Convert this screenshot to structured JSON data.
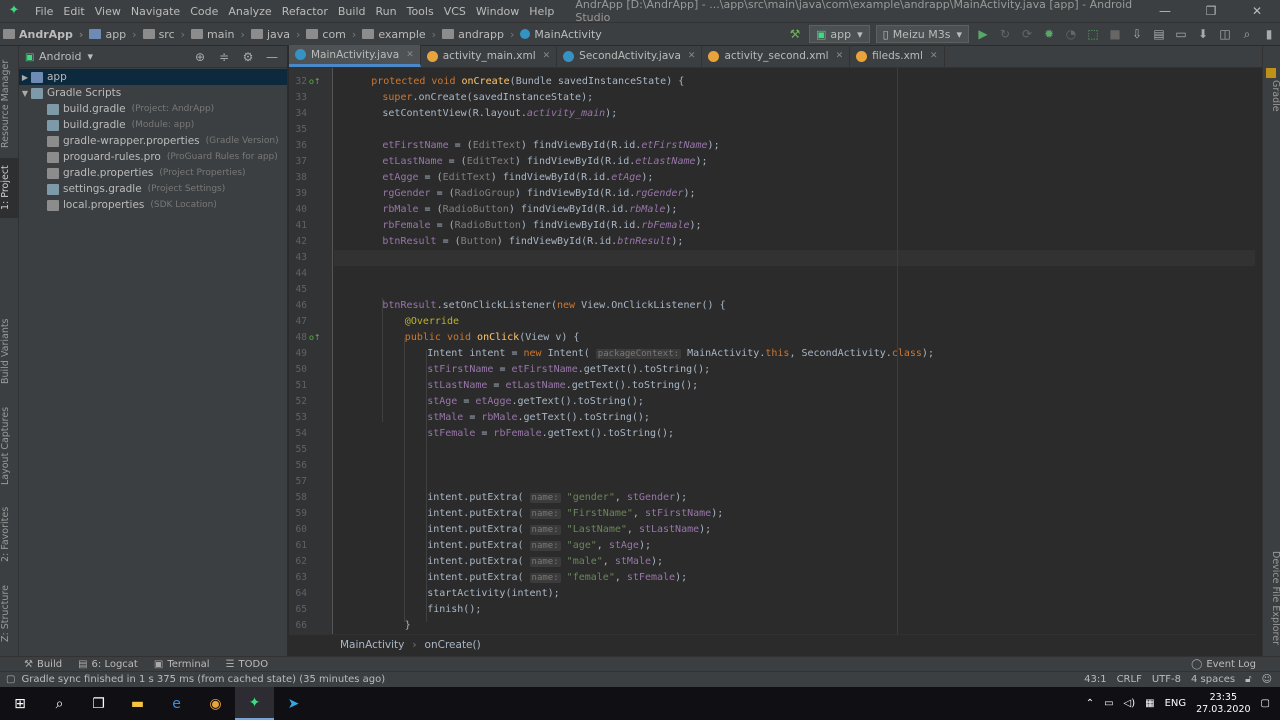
{
  "window": {
    "app_icon": "android-studio-icon",
    "title": "AndrApp [D:\\AndrApp] - ...\\app\\src\\main\\java\\com\\example\\andrapp\\MainActivity.java [app] - Android Studio",
    "menu": [
      "File",
      "Edit",
      "View",
      "Navigate",
      "Code",
      "Analyze",
      "Refactor",
      "Build",
      "Run",
      "Tools",
      "VCS",
      "Window",
      "Help"
    ]
  },
  "breadcrumbs": [
    "AndrApp",
    "app",
    "src",
    "main",
    "java",
    "com",
    "example",
    "andrapp",
    "MainActivity"
  ],
  "toolbar": {
    "run_config": "app",
    "device": "Meizu M3s"
  },
  "left_tool_tabs": [
    "Resource Manager",
    "1: Project",
    "Build Variants",
    "Layout Captures",
    "2: Favorites",
    "Z: Structure"
  ],
  "right_tool_tabs": [
    "Gradle",
    "Device File Explorer"
  ],
  "project": {
    "view": "Android",
    "tree": [
      {
        "label": "app",
        "hint": "",
        "level": 0,
        "arrow": "▶",
        "type": "folder"
      },
      {
        "label": "Gradle Scripts",
        "hint": "",
        "level": 0,
        "arrow": "▼",
        "type": "gradle"
      },
      {
        "label": "build.gradle",
        "hint": "(Project: AndrApp)",
        "level": 1,
        "arrow": "",
        "type": "gradle"
      },
      {
        "label": "build.gradle",
        "hint": "(Module: app)",
        "level": 1,
        "arrow": "",
        "type": "gradle"
      },
      {
        "label": "gradle-wrapper.properties",
        "hint": "(Gradle Version)",
        "level": 1,
        "arrow": "",
        "type": "props"
      },
      {
        "label": "proguard-rules.pro",
        "hint": "(ProGuard Rules for app)",
        "level": 1,
        "arrow": "",
        "type": "file"
      },
      {
        "label": "gradle.properties",
        "hint": "(Project Properties)",
        "level": 1,
        "arrow": "",
        "type": "props"
      },
      {
        "label": "settings.gradle",
        "hint": "(Project Settings)",
        "level": 1,
        "arrow": "",
        "type": "gradle"
      },
      {
        "label": "local.properties",
        "hint": "(SDK Location)",
        "level": 1,
        "arrow": "",
        "type": "props"
      }
    ]
  },
  "tabs": [
    {
      "label": "MainActivity.java",
      "active": true,
      "color": "#3592c4"
    },
    {
      "label": "activity_main.xml",
      "active": false,
      "color": "#e8a33d"
    },
    {
      "label": "SecondActivity.java",
      "active": false,
      "color": "#3592c4"
    },
    {
      "label": "activity_second.xml",
      "active": false,
      "color": "#e8a33d"
    },
    {
      "label": "fileds.xml",
      "active": false,
      "color": "#e8a33d"
    }
  ],
  "editor": {
    "cursor_line": 43,
    "gutter_marks": {
      "32": "o↑",
      "48": "o↑"
    },
    "lines": [
      {
        "n": 32,
        "i": 2,
        "t": [
          [
            "kw",
            "protected void "
          ],
          [
            "fn",
            "onCreate"
          ],
          [
            "",
            "(Bundle savedInstanceState) {"
          ]
        ]
      },
      {
        "n": 33,
        "i": 4,
        "t": [
          [
            "kw",
            "super"
          ],
          [
            "",
            ".onCreate(savedInstanceState);"
          ]
        ]
      },
      {
        "n": 34,
        "i": 4,
        "t": [
          [
            "",
            "setContentView(R.layout."
          ],
          [
            "fldi",
            "activity_main"
          ],
          [
            "",
            ");"
          ]
        ]
      },
      {
        "n": 35,
        "i": 0,
        "t": []
      },
      {
        "n": 36,
        "i": 4,
        "t": [
          [
            "fld",
            "etFirstName"
          ],
          [
            "",
            " = ("
          ],
          [
            "cast",
            "EditText"
          ],
          [
            "",
            ") findViewById(R.id."
          ],
          [
            "fldi",
            "etFirstName"
          ],
          [
            "",
            ");"
          ]
        ]
      },
      {
        "n": 37,
        "i": 4,
        "t": [
          [
            "fld",
            "etLastName"
          ],
          [
            "",
            " = ("
          ],
          [
            "cast",
            "EditText"
          ],
          [
            "",
            ") findViewById(R.id."
          ],
          [
            "fldi",
            "etLastName"
          ],
          [
            "",
            ");"
          ]
        ]
      },
      {
        "n": 38,
        "i": 4,
        "t": [
          [
            "fld",
            "etAgge"
          ],
          [
            "",
            " = ("
          ],
          [
            "cast",
            "EditText"
          ],
          [
            "",
            ") findViewById(R.id."
          ],
          [
            "fldi",
            "etAge"
          ],
          [
            "",
            ");"
          ]
        ]
      },
      {
        "n": 39,
        "i": 4,
        "t": [
          [
            "fld",
            "rgGender"
          ],
          [
            "",
            " = ("
          ],
          [
            "cast",
            "RadioGroup"
          ],
          [
            "",
            ") findViewById(R.id."
          ],
          [
            "fldi",
            "rgGender"
          ],
          [
            "",
            ");"
          ]
        ]
      },
      {
        "n": 40,
        "i": 4,
        "t": [
          [
            "fld",
            "rbMale"
          ],
          [
            "",
            " = ("
          ],
          [
            "cast",
            "RadioButton"
          ],
          [
            "",
            ") findViewById(R.id."
          ],
          [
            "fldi",
            "rbMale"
          ],
          [
            "",
            ");"
          ]
        ]
      },
      {
        "n": 41,
        "i": 4,
        "t": [
          [
            "fld",
            "rbFemale"
          ],
          [
            "",
            " = ("
          ],
          [
            "cast",
            "RadioButton"
          ],
          [
            "",
            ") findViewById(R.id."
          ],
          [
            "fldi",
            "rbFemale"
          ],
          [
            "",
            ");"
          ]
        ]
      },
      {
        "n": 42,
        "i": 4,
        "t": [
          [
            "fld",
            "btnResult"
          ],
          [
            "",
            " = ("
          ],
          [
            "cast",
            "Button"
          ],
          [
            "",
            ") findViewById(R.id."
          ],
          [
            "fldi",
            "btnResult"
          ],
          [
            "",
            ");"
          ]
        ]
      },
      {
        "n": 43,
        "i": 0,
        "t": []
      },
      {
        "n": 44,
        "i": 0,
        "t": []
      },
      {
        "n": 45,
        "i": 0,
        "t": []
      },
      {
        "n": 46,
        "i": 4,
        "t": [
          [
            "fld",
            "btnResult"
          ],
          [
            "",
            ".setOnClickListener("
          ],
          [
            "kw",
            "new "
          ],
          [
            "",
            "View.OnClickListener() {"
          ]
        ]
      },
      {
        "n": 47,
        "i": 8,
        "t": [
          [
            "ann",
            "@Override"
          ]
        ]
      },
      {
        "n": 48,
        "i": 8,
        "t": [
          [
            "kw",
            "public void "
          ],
          [
            "fn",
            "onClick"
          ],
          [
            "",
            "(View v) {"
          ]
        ]
      },
      {
        "n": 49,
        "i": 12,
        "t": [
          [
            "",
            "Intent intent = "
          ],
          [
            "kw",
            "new "
          ],
          [
            "",
            "Intent( "
          ],
          [
            "hint",
            "packageContext:"
          ],
          [
            "",
            " MainActivity."
          ],
          [
            "kw",
            "this"
          ],
          [
            "",
            ", SecondActivity."
          ],
          [
            "kw",
            "class"
          ],
          [
            "",
            ");"
          ]
        ]
      },
      {
        "n": 50,
        "i": 12,
        "t": [
          [
            "fld",
            "stFirstName"
          ],
          [
            "",
            " = "
          ],
          [
            "fld",
            "etFirstName"
          ],
          [
            "",
            ".getText().toString();"
          ]
        ]
      },
      {
        "n": 51,
        "i": 12,
        "t": [
          [
            "fld",
            "stLastName"
          ],
          [
            "",
            " = "
          ],
          [
            "fld",
            "etLastName"
          ],
          [
            "",
            ".getText().toString();"
          ]
        ]
      },
      {
        "n": 52,
        "i": 12,
        "t": [
          [
            "fld",
            "stAge"
          ],
          [
            "",
            " = "
          ],
          [
            "fld",
            "etAgge"
          ],
          [
            "",
            ".getText().toString();"
          ]
        ]
      },
      {
        "n": 53,
        "i": 12,
        "t": [
          [
            "fld",
            "stMale"
          ],
          [
            "",
            " = "
          ],
          [
            "fld",
            "rbMale"
          ],
          [
            "",
            ".getText().toString();"
          ]
        ]
      },
      {
        "n": 54,
        "i": 12,
        "t": [
          [
            "fld",
            "stFemale"
          ],
          [
            "",
            " = "
          ],
          [
            "fld",
            "rbFemale"
          ],
          [
            "",
            ".getText().toString();"
          ]
        ]
      },
      {
        "n": 55,
        "i": 0,
        "t": []
      },
      {
        "n": 56,
        "i": 0,
        "t": []
      },
      {
        "n": 57,
        "i": 0,
        "t": []
      },
      {
        "n": 58,
        "i": 12,
        "t": [
          [
            "",
            "intent.putExtra( "
          ],
          [
            "hint",
            "name:"
          ],
          [
            "",
            " "
          ],
          [
            "str",
            "\"gender\""
          ],
          [
            "",
            ", "
          ],
          [
            "fld",
            "stGender"
          ],
          [
            "",
            ");"
          ]
        ]
      },
      {
        "n": 59,
        "i": 12,
        "t": [
          [
            "",
            "intent.putExtra( "
          ],
          [
            "hint",
            "name:"
          ],
          [
            "",
            " "
          ],
          [
            "str",
            "\"FirstName\""
          ],
          [
            "",
            ", "
          ],
          [
            "fld",
            "stFirstName"
          ],
          [
            "",
            ");"
          ]
        ]
      },
      {
        "n": 60,
        "i": 12,
        "t": [
          [
            "",
            "intent.putExtra( "
          ],
          [
            "hint",
            "name:"
          ],
          [
            "",
            " "
          ],
          [
            "str",
            "\"LastName\""
          ],
          [
            "",
            ", "
          ],
          [
            "fld",
            "stLastName"
          ],
          [
            "",
            ");"
          ]
        ]
      },
      {
        "n": 61,
        "i": 12,
        "t": [
          [
            "",
            "intent.putExtra( "
          ],
          [
            "hint",
            "name:"
          ],
          [
            "",
            " "
          ],
          [
            "str",
            "\"age\""
          ],
          [
            "",
            ", "
          ],
          [
            "fld",
            "stAge"
          ],
          [
            "",
            ");"
          ]
        ]
      },
      {
        "n": 62,
        "i": 12,
        "t": [
          [
            "",
            "intent.putExtra( "
          ],
          [
            "hint",
            "name:"
          ],
          [
            "",
            " "
          ],
          [
            "str",
            "\"male\""
          ],
          [
            "",
            ", "
          ],
          [
            "fld",
            "stMale"
          ],
          [
            "",
            ");"
          ]
        ]
      },
      {
        "n": 63,
        "i": 12,
        "t": [
          [
            "",
            "intent.putExtra( "
          ],
          [
            "hint",
            "name:"
          ],
          [
            "",
            " "
          ],
          [
            "str",
            "\"female\""
          ],
          [
            "",
            ", "
          ],
          [
            "fld",
            "stFemale"
          ],
          [
            "",
            ");"
          ]
        ]
      },
      {
        "n": 64,
        "i": 12,
        "t": [
          [
            "",
            "startActivity(intent);"
          ]
        ]
      },
      {
        "n": 65,
        "i": 12,
        "t": [
          [
            "",
            "finish();"
          ]
        ]
      },
      {
        "n": 66,
        "i": 8,
        "t": [
          [
            "",
            "}"
          ]
        ]
      }
    ]
  },
  "editor_breadcrumb": [
    "MainActivity",
    "onCreate()"
  ],
  "tool_windows": [
    {
      "icon": "hammer-icon",
      "label": "Build"
    },
    {
      "icon": "logcat-icon",
      "label": "6: Logcat"
    },
    {
      "icon": "terminal-icon",
      "label": "Terminal"
    },
    {
      "icon": "todo-icon",
      "label": "TODO"
    }
  ],
  "event_log": "Event Log",
  "status": {
    "message": "Gradle sync finished in 1 s 375 ms (from cached state) (35 minutes ago)",
    "position": "43:1",
    "line_sep": "CRLF",
    "encoding": "UTF-8",
    "indent": "4 spaces"
  },
  "taskbar": {
    "apps": [
      "windows-start-icon",
      "search-icon",
      "task-view-icon",
      "file-explorer-icon",
      "edge-icon",
      "chrome-icon",
      "android-studio-icon",
      "telegram-icon"
    ],
    "lang": "ENG",
    "time": "23:35",
    "date": "27.03.2020"
  }
}
